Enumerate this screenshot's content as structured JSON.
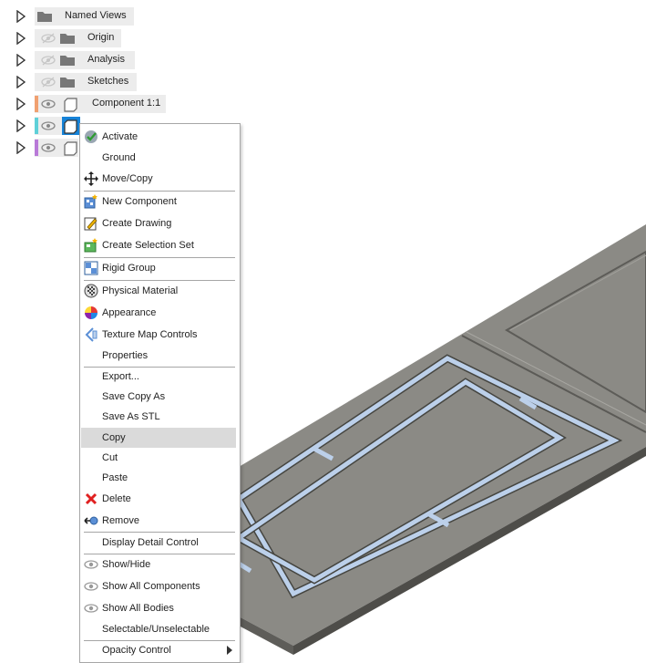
{
  "browser_tree": [
    {
      "label": "Named Views"
    },
    {
      "label": "Origin"
    },
    {
      "label": "Analysis"
    },
    {
      "label": "Sketches"
    },
    {
      "label": "Component 1:1",
      "color": "#f0a070"
    },
    {
      "label": "",
      "color": "#5fd0d8"
    },
    {
      "label": "",
      "color": "#b97ad8"
    }
  ],
  "context_menu": {
    "items": [
      {
        "label": "Activate",
        "icon": "check-icon"
      },
      {
        "label": "Ground",
        "icon": ""
      },
      {
        "label": "Move/Copy",
        "icon": "move-icon"
      },
      {
        "label": "New Component",
        "icon": "new-component-icon"
      },
      {
        "label": "Create Drawing",
        "icon": "create-drawing-icon"
      },
      {
        "label": "Create Selection Set",
        "icon": "selection-set-icon"
      },
      {
        "label": "Rigid Group",
        "icon": "rigid-group-icon"
      },
      {
        "label": "Physical Material",
        "icon": "physical-material-icon"
      },
      {
        "label": "Appearance",
        "icon": "appearance-icon"
      },
      {
        "label": "Texture Map Controls",
        "icon": "texture-map-icon"
      },
      {
        "label": "Properties",
        "icon": ""
      },
      {
        "label": "Export...",
        "icon": ""
      },
      {
        "label": "Save Copy As",
        "icon": ""
      },
      {
        "label": "Save As STL",
        "icon": ""
      },
      {
        "label": "Copy",
        "icon": "",
        "highlighted": true
      },
      {
        "label": "Cut",
        "icon": ""
      },
      {
        "label": "Paste",
        "icon": ""
      },
      {
        "label": "Delete",
        "icon": "delete-icon"
      },
      {
        "label": "Remove",
        "icon": "remove-icon"
      },
      {
        "label": "Display Detail Control",
        "icon": ""
      },
      {
        "label": "Show/Hide",
        "icon": "eye-icon"
      },
      {
        "label": "Show All Components",
        "icon": "eye-icon"
      },
      {
        "label": "Show All Bodies",
        "icon": "eye-icon"
      },
      {
        "label": "Selectable/Unselectable",
        "icon": ""
      },
      {
        "label": "Opacity Control",
        "icon": "",
        "submenu": true
      }
    ]
  },
  "colors": {
    "model_top": "#8b8a85",
    "model_side": "#4e4d49",
    "frame": "#bcd0ea",
    "selection": "#1683d8",
    "menu_highlight": "#dadada"
  }
}
